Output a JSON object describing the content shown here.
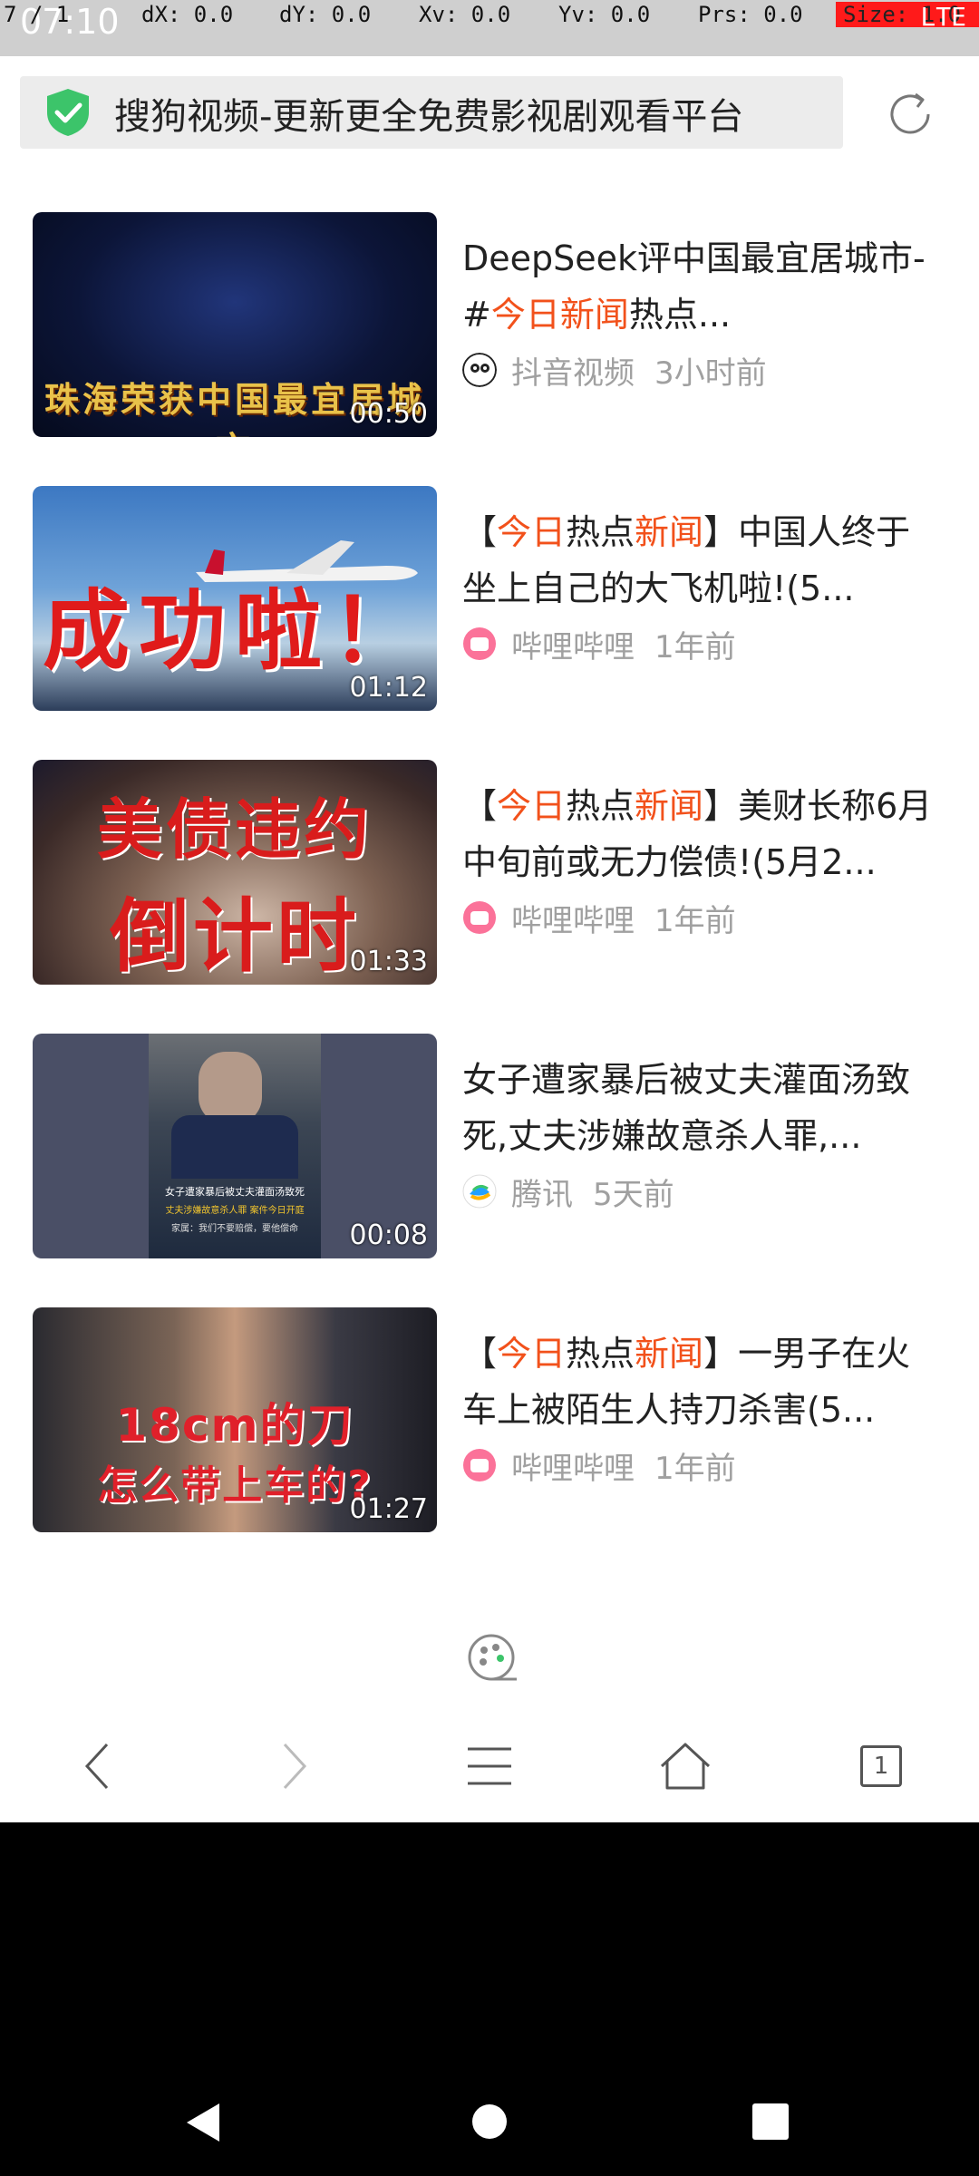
{
  "status_bar": {
    "time": "07:10",
    "network": "LTE"
  },
  "debug_overlay": {
    "pointer": "7 / 1",
    "dx": "dX: 0.0",
    "dy": "dY: 0.0",
    "xv": "Xv: 0.0",
    "yv": "Yv: 0.0",
    "prs": "Prs: 0.0",
    "size": "Size: 1.0"
  },
  "address_bar": {
    "title": "搜狗视频-更新更全免费影视剧观看平台"
  },
  "videos": [
    {
      "thumb_caption": "珠海荣获中国最宜居城市",
      "duration": "00:50",
      "title_parts": [
        "DeepSeek评中国最宜居城市-#",
        "今日新闻",
        "热点..."
      ],
      "source": "抖音视频",
      "time_ago": "3小时前"
    },
    {
      "thumb_caption": "成功啦！",
      "duration": "01:12",
      "title_parts": [
        "【",
        "今日",
        "热点",
        "新闻",
        "】中国人终于坐上自己的大飞机啦!(5..."
      ],
      "source": "哔哩哔哩",
      "time_ago": "1年前"
    },
    {
      "thumb_caption_line1": "美债违约",
      "thumb_caption_line2": "倒计时",
      "duration": "01:33",
      "title_parts": [
        "【",
        "今日",
        "热点",
        "新闻",
        "】美财长称6月中旬前或无力偿债!(5月2..."
      ],
      "source": "哔哩哔哩",
      "time_ago": "1年前"
    },
    {
      "thumb_caption_line1": "女子遭家暴后被丈夫灌面汤致死",
      "thumb_caption_line2": "丈夫涉嫌故意杀人罪 案件今日开庭",
      "thumb_caption_line3": "家属：我们不要赔偿，要他偿命",
      "duration": "00:08",
      "title_parts": [
        "女子遭家暴后被丈夫灌面汤致死,丈夫涉嫌故意杀人罪,..."
      ],
      "source": "腾讯",
      "time_ago": "5天前"
    },
    {
      "thumb_caption_line1": "18cm的刀",
      "thumb_caption_line2": "怎么带上车的?",
      "duration": "01:27",
      "title_parts": [
        "【",
        "今日",
        "热点",
        "新闻",
        "】一男子在火车上被陌生人持刀杀害(5..."
      ],
      "source": "哔哩哔哩",
      "time_ago": "1年前"
    }
  ],
  "bottom_nav": {
    "tabs_count": "1"
  },
  "colors": {
    "accent": "#f2511b",
    "shield": "#3cc46a",
    "meta": "#a0a0a0"
  }
}
